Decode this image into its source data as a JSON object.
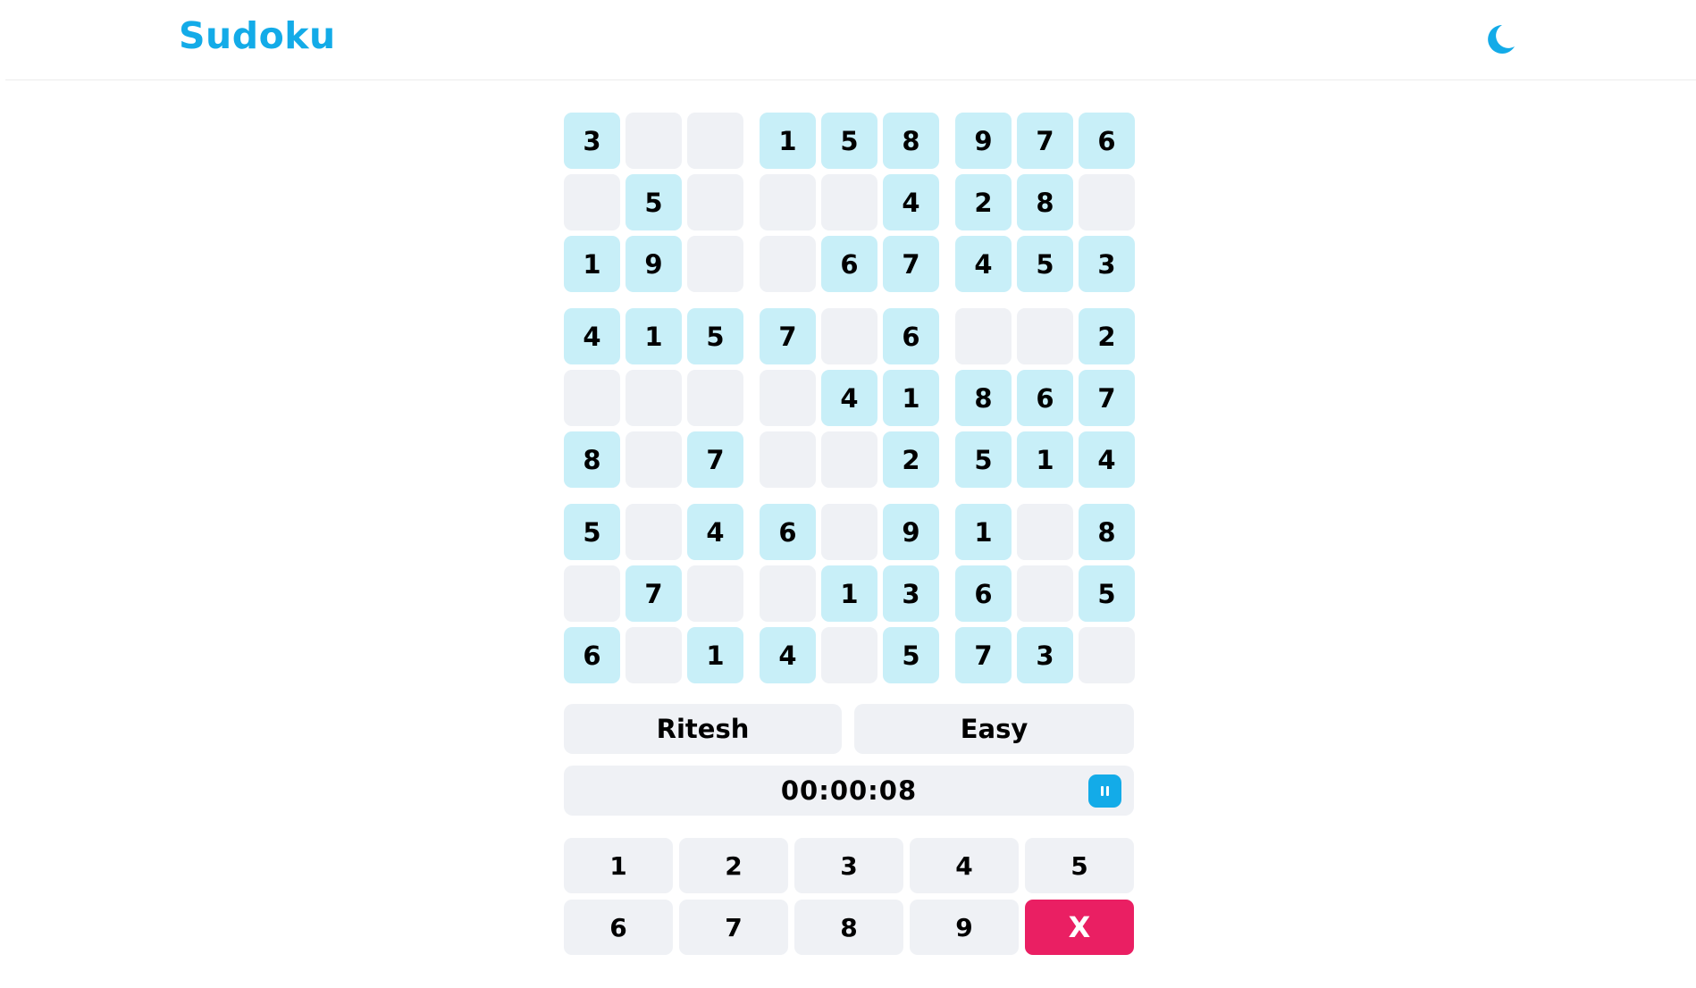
{
  "header": {
    "title": "Sudoku",
    "theme_icon": "moon-icon",
    "accent": "#13abe8"
  },
  "board": {
    "filled_color": "#c8eff8",
    "empty_color": "#eff1f5",
    "cells": [
      [
        "3",
        "",
        "",
        "1",
        "5",
        "8",
        "9",
        "7",
        "6"
      ],
      [
        "",
        "5",
        "",
        "",
        "",
        "4",
        "2",
        "8",
        ""
      ],
      [
        "1",
        "9",
        "",
        "",
        "6",
        "7",
        "4",
        "5",
        "3"
      ],
      [
        "4",
        "1",
        "5",
        "7",
        "",
        "6",
        "",
        "",
        "2"
      ],
      [
        "",
        "",
        "",
        "",
        "4",
        "1",
        "8",
        "6",
        "7"
      ],
      [
        "8",
        "",
        "7",
        "",
        "",
        "2",
        "5",
        "1",
        "4"
      ],
      [
        "5",
        "",
        "4",
        "6",
        "",
        "9",
        "1",
        "",
        "8"
      ],
      [
        "",
        "7",
        "",
        "",
        "1",
        "3",
        "6",
        "",
        "5"
      ],
      [
        "6",
        "",
        "1",
        "4",
        "",
        "5",
        "7",
        "3",
        ""
      ]
    ]
  },
  "info": {
    "player": "Ritesh",
    "difficulty": "Easy"
  },
  "timer": {
    "value": "00:00:08",
    "pause_icon": "pause-icon"
  },
  "numpad": {
    "keys": [
      "1",
      "2",
      "3",
      "4",
      "5",
      "6",
      "7",
      "8",
      "9"
    ],
    "erase_label": "X",
    "erase_color": "#ea1f63"
  }
}
